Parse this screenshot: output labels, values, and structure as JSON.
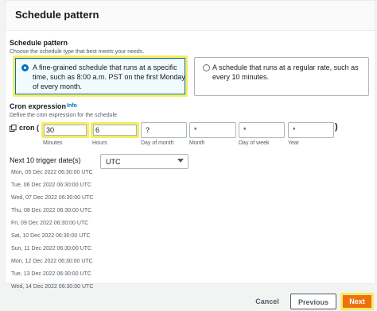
{
  "header": {
    "title": "Schedule pattern"
  },
  "schedule_pattern": {
    "label": "Schedule pattern",
    "description": "Choose the schedule type that best meets your needs.",
    "options": [
      {
        "line1": "A fine-grained schedule that runs at a specific",
        "line2": "time, such as 8:00 a.m. PST on the first Monday",
        "line3": "of every month.",
        "selected": true
      },
      {
        "line1": "A schedule that runs at a regular rate, such as",
        "line2": "every 10 minutes.",
        "selected": false
      }
    ]
  },
  "cron": {
    "label": "Cron expression",
    "info": "Info",
    "description": "Define the cron expression for the schedule",
    "prefix": "cron (",
    "suffix": ")",
    "fields": [
      {
        "value": "30",
        "caption": "Minutes"
      },
      {
        "value": "6",
        "caption": "Hours"
      },
      {
        "value": "?",
        "caption": "Day of month"
      },
      {
        "value": "*",
        "caption": "Month"
      },
      {
        "value": "*",
        "caption": "Day of week"
      },
      {
        "value": "*",
        "caption": "Year"
      }
    ]
  },
  "triggers": {
    "label": "Next 10 trigger date(s)",
    "timezone": "UTC",
    "dates": [
      "Mon, 05 Dec 2022 06:30:00 UTC",
      "Tue, 06 Dec 2022 06:30:00 UTC",
      "Wed, 07 Dec 2022 06:30:00 UTC",
      "Thu, 08 Dec 2022 06:30:00 UTC",
      "Fri, 09 Dec 2022 06:30:00 UTC",
      "Sat, 10 Dec 2022 06:30:00 UTC",
      "Sun, 11 Dec 2022 06:30:00 UTC",
      "Mon, 12 Dec 2022 06:30:00 UTC",
      "Tue, 13 Dec 2022 06:30:00 UTC",
      "Wed, 14 Dec 2022 06:30:00 UTC"
    ]
  },
  "footer": {
    "cancel": "Cancel",
    "previous": "Previous",
    "next": "Next"
  },
  "colors": {
    "accent": "#0073bb",
    "primary_button": "#ec7211",
    "highlight": "#f5ec62"
  }
}
